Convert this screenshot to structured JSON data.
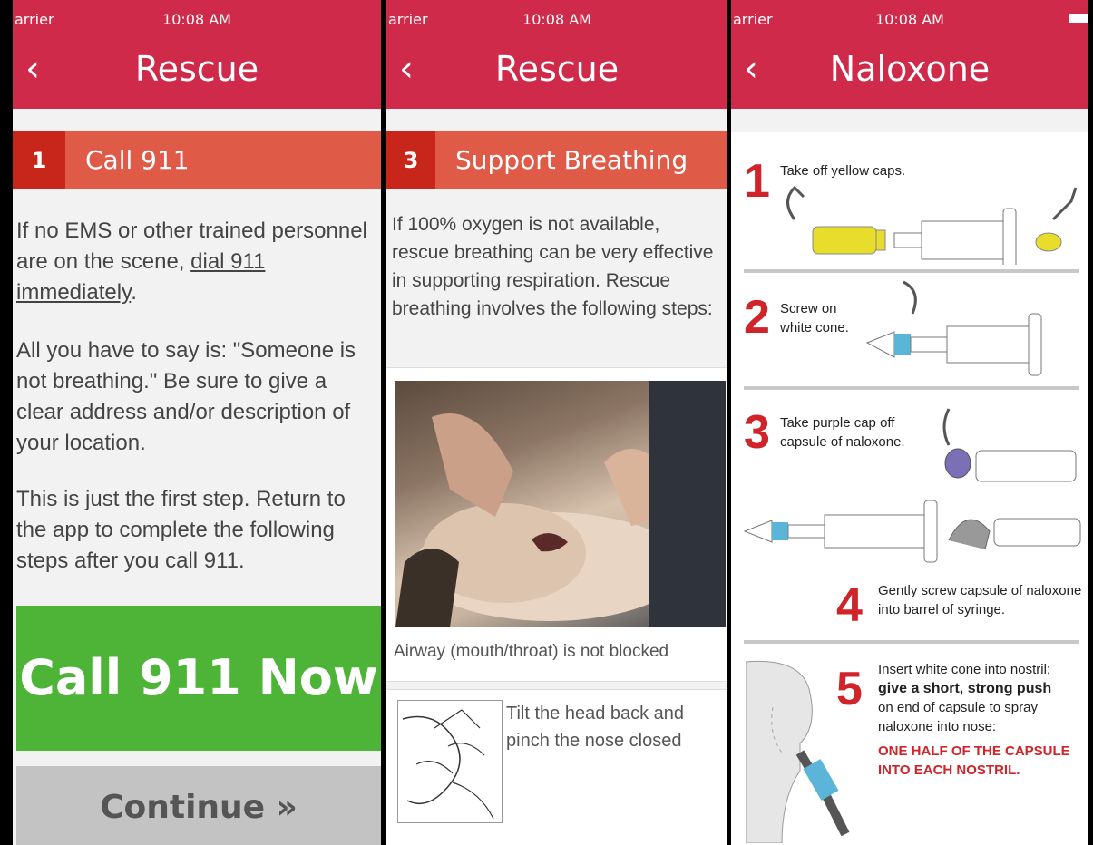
{
  "screen1": {
    "status": {
      "carrier": "arrier",
      "time": "10:08 AM"
    },
    "nav": {
      "back_glyph": "‹",
      "title": "Rescue"
    },
    "step": {
      "number": "1",
      "label": "Call 911"
    },
    "para1_pre": "If no EMS or other trained personnel are on the scene, ",
    "para1_link": "dial 911 immediately",
    "para1_post": ".",
    "para2": "All you have to say is: \"Someone is not breathing.\" Be sure to give a clear address and/or description of your location.",
    "para3": "This is just the first step. Return to the app to complete the following steps after you call 911.",
    "call_button": "Call 911 Now",
    "continue_button": "Continue »"
  },
  "screen2": {
    "status": {
      "carrier": "arrier",
      "time": "10:08 AM"
    },
    "nav": {
      "back_glyph": "‹",
      "title": "Rescue"
    },
    "step": {
      "number": "3",
      "label": "Support Breathing"
    },
    "intro": "If 100% oxygen is not available, rescue breathing can be very effective in supporting respiration. Rescue breathing involves the following steps:",
    "photo_caption": "Airway (mouth/throat) is not blocked",
    "item2_text": "Tilt the head back and pinch the nose closed"
  },
  "screen3": {
    "status": {
      "carrier": "arrier",
      "time": "10:08 AM"
    },
    "nav": {
      "back_glyph": "‹",
      "title": "Naloxone"
    },
    "steps": [
      {
        "num": "1",
        "text": "Take off yellow caps."
      },
      {
        "num": "2",
        "text": "Screw on white cone."
      },
      {
        "num": "3",
        "text": "Take purple cap off capsule of naloxone."
      },
      {
        "num": "4",
        "text": "Gently screw capsule of naloxone into barrel of syringe."
      },
      {
        "num": "5",
        "text_a": "Insert white cone into nostril;",
        "text_b": "give a short, strong push",
        "text_c": "on end of capsule to spray naloxone into nose:",
        "warning": "ONE HALF OF THE CAPSULE INTO EACH NOSTRIL."
      }
    ]
  },
  "colors": {
    "brand_red": "#cf2a4a",
    "step_orange": "#e05a48",
    "step_num": "#c8261b",
    "call_green": "#4db437",
    "continue_gray": "#c3c3c3",
    "diagram_red": "#d0232a",
    "yellow_cap": "#e8dd2a",
    "blue_part": "#5bb5d8",
    "purple_cap": "#7b6fb8"
  }
}
